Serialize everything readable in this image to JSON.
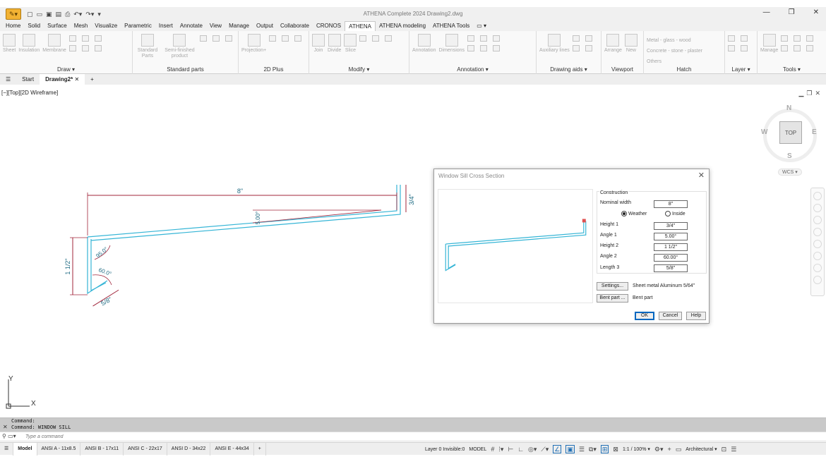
{
  "window": {
    "title": "ATHENA Complete 2024   Drawing2.dwg",
    "minimize_icon": "minimize-icon",
    "maximize_icon": "restore-icon",
    "close_icon": "close-icon"
  },
  "ribbon_tabs": [
    "Home",
    "Solid",
    "Surface",
    "Mesh",
    "Visualize",
    "Parametric",
    "Insert",
    "Annotate",
    "View",
    "Manage",
    "Output",
    "Collaborate",
    "CRONOS",
    "ATHENA",
    "ATHENA modeling",
    "ATHENA Tools"
  ],
  "active_ribbon_tab": "ATHENA",
  "ribbon_panels": {
    "draw": {
      "label": "Draw ▾",
      "tools": [
        "Sheet",
        "Insulation",
        "Membrane"
      ]
    },
    "standard_parts": {
      "label": "Standard parts",
      "tools": [
        "Standard Parts",
        "Semi-finished product"
      ]
    },
    "plus2d": {
      "label": "2D Plus",
      "tools": [
        "Projection+"
      ]
    },
    "modify": {
      "label": "Modify ▾",
      "tools": [
        "Join",
        "Divide",
        "Slice"
      ]
    },
    "annotation": {
      "label": "Annotation ▾",
      "tools": [
        "Annotation",
        "Dimensions"
      ]
    },
    "drawing_aids": {
      "label": "Drawing aids ▾",
      "tools": [
        "Auxiliary lines"
      ]
    },
    "viewport": {
      "label": "Viewport",
      "tools": [
        "Arrange",
        "New"
      ]
    },
    "hatch": {
      "label": "Hatch",
      "items": [
        "Metal - glass - wood",
        "Concrete - stone - plaster",
        "Others"
      ]
    },
    "layer": {
      "label": "Layer ▾"
    },
    "tools": {
      "label": "Tools ▾",
      "tools": [
        "Manage"
      ]
    }
  },
  "file_tabs": {
    "menu_icon": "hamburger-menu-icon",
    "start": "Start",
    "drawing": "Drawing2*",
    "add": "+"
  },
  "viewport": {
    "label": "[−][Top][2D Wireframe]"
  },
  "viewcube": {
    "face": "TOP",
    "north": "N",
    "south": "S",
    "east": "E",
    "west": "W",
    "wcs": "WCS ▾"
  },
  "ucs": {
    "x": "X",
    "y": "Y"
  },
  "drawing_labels": {
    "width": "8\"",
    "height1": "3/4\"",
    "angle1": "5.00°",
    "angle2": "95.0°",
    "angle3": "60.0°",
    "height2": "1 1/2\"",
    "length3": "5/8\""
  },
  "dialog": {
    "title": "Window Sill Cross Section",
    "group": "Construction",
    "nominal_width_label": "Nominal width",
    "nominal_width": "8\"",
    "radio_weather": "Weather",
    "radio_inside": "Inside",
    "height1_label": "Height 1",
    "height1": "3/4\"",
    "angle1_label": "Angle  1",
    "angle1": "5.00°",
    "height2_label": "Height 2",
    "height2": "1 1/2\"",
    "angle2_label": "Angle  2",
    "angle2": "60.00°",
    "length3_label": "Length 3",
    "length3": "5/8\"",
    "settings_button": "Settings...",
    "settings_text": "Sheet metal Aluminum 5/64\"",
    "bent_part_button": "Bent part ...",
    "bent_part_text": "Bent part",
    "ok": "OK",
    "cancel": "Cancel",
    "help": "Help"
  },
  "command": {
    "history": [
      "Command:",
      "Command:  WINDOW SILL"
    ],
    "placeholder": "Type a command"
  },
  "status": {
    "layout_tabs": [
      "Model",
      "ANSI A - 11x8.5",
      "ANSI B - 17x11",
      "ANSI C - 22x17",
      "ANSI D - 34x22",
      "ANSI E - 44x34"
    ],
    "layer_info": "Layer 0 Invisible:0",
    "model": "MODEL",
    "scale": "1:1 / 100% ▾",
    "units": "Architectural ▾"
  },
  "colors": {
    "profile": "#35b5d6",
    "dimension": "#a0243a",
    "dim_text": "#1f6b83",
    "accent": "#0067c0"
  }
}
